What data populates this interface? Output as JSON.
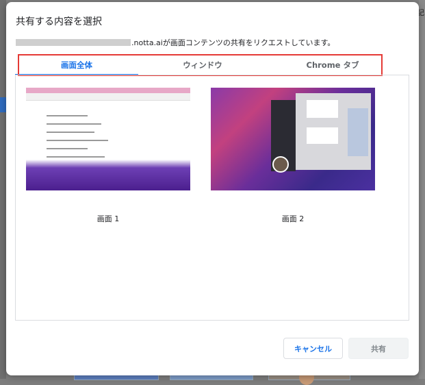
{
  "dialog": {
    "title": "共有する内容を選択",
    "subtitle_domain": ".notta.ai",
    "subtitle_rest": " が画面コンテンツの共有をリクエストしています。"
  },
  "tabs": [
    {
      "label": "画面全体",
      "selected": true
    },
    {
      "label": "ウィンドウ",
      "selected": false
    },
    {
      "label": "Chrome タブ",
      "selected": false
    }
  ],
  "screens": [
    {
      "label": "画面 1"
    },
    {
      "label": "画面 2"
    }
  ],
  "buttons": {
    "cancel": "キャンセル",
    "share": "共有"
  },
  "background": {
    "right_text": "記"
  },
  "colors": {
    "accent": "#1a73e8",
    "highlight": "#e53935"
  }
}
